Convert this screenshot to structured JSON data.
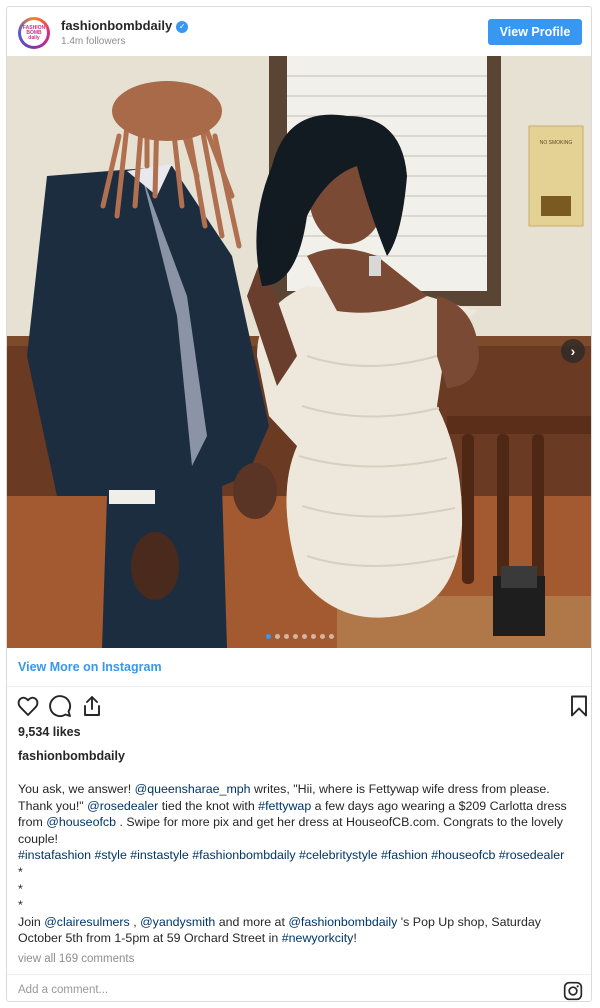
{
  "header": {
    "avatar_text": "FASHION BOMB daily",
    "username": "fashionbombdaily",
    "verified_mark": "✓",
    "followers": "1.4m followers",
    "view_profile_label": "View Profile"
  },
  "media": {
    "slide_count": 8,
    "active_slide": 1,
    "next_icon": "chevron-right-icon",
    "sign_text": "NO SMOKING"
  },
  "view_more_label": "View More on Instagram",
  "actions": {
    "icons": [
      "heart-icon",
      "comment-icon",
      "share-icon",
      "bookmark-icon"
    ]
  },
  "likes": "9,534 likes",
  "author": "fashionbombdaily",
  "caption": {
    "part1": "You ask, we answer! ",
    "mention1": "@queensharae_mph",
    "part2": " writes, \"Hii, where is Fettywap wife dress from please. Thank you!\" ",
    "mention2": "@rosedealer",
    "part3": " tied the knot with ",
    "tag1": "#fettywap",
    "part4": " a few days ago wearing a $209 Carlotta dress from ",
    "mention3": "@houseofcb",
    "part5": " . Swipe for more pix and get her dress at HouseofCB.com. Congrats to the lovely couple!\n",
    "hashtags": "#instafashion #style #instastyle #fashionbombdaily #celebritystyle #fashion #houseofcb #rosedealer",
    "stars": "\n*\n*\n*\n",
    "part6": "Join ",
    "mention4": "@clairesulmers",
    "part7": " , ",
    "mention5": "@yandysmith",
    "part8": " and more at ",
    "mention6": "@fashionbombdaily",
    "part9": " 's Pop Up shop, Saturday October 5th from 1-5pm at 59 Orchard Street in ",
    "tag2": "#newyorkcity",
    "part10": "!"
  },
  "comments_link": "view all 169 comments",
  "comment_placeholder": "Add a comment...",
  "footer_icon": "instagram-icon"
}
